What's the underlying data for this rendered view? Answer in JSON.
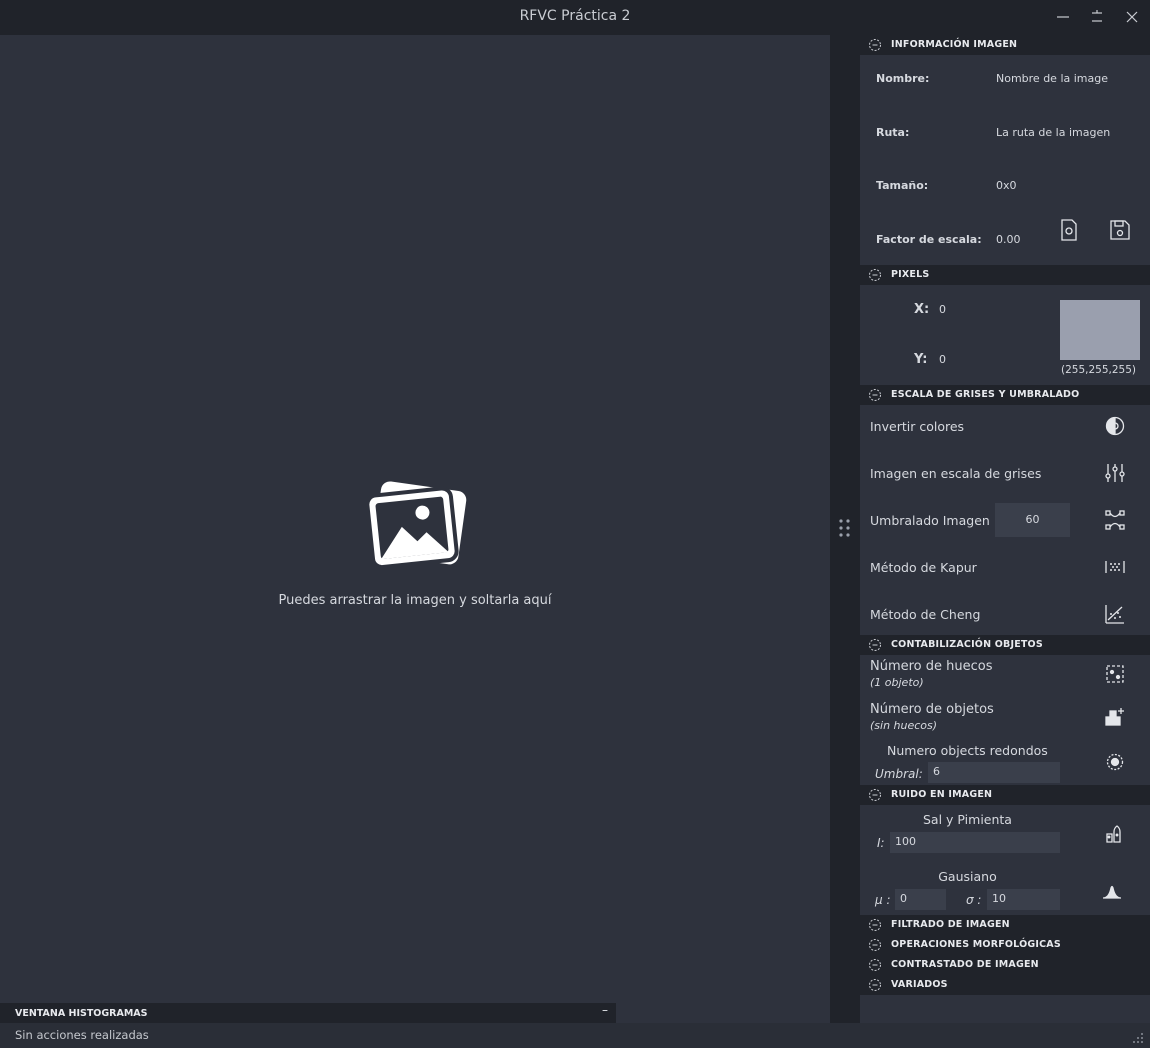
{
  "window": {
    "title": "RFVC Práctica 2"
  },
  "canvas": {
    "drop_text": "Puedes arrastrar la imagen y soltarla aquí",
    "drop_icon": "images-icon"
  },
  "info": {
    "title": "INFORMACIÓN IMAGEN",
    "name_label": "Nombre:",
    "name_value": "Nombre de la image",
    "path_label": "Ruta:",
    "path_value": "La ruta de la imagen",
    "size_label": "Tamaño:",
    "size_value": "0x0",
    "scale_label": "Factor de escala:",
    "scale_value": "0.00"
  },
  "pixels": {
    "title": "PIXELS",
    "x_label": "X:",
    "x_value": "0",
    "y_label": "Y:",
    "y_value": "0",
    "rgb": "(255,255,255)",
    "swatch_color": "#9a9fae"
  },
  "grayscale": {
    "title": "ESCALA DE GRISES Y UMBRALADO",
    "invert": "Invertir colores",
    "gray": "Imagen en escala de grises",
    "threshold": "Umbralado Imagen",
    "threshold_value": "60",
    "kapur": "Método de Kapur",
    "cheng": "Método de Cheng"
  },
  "counting": {
    "title": "CONTABILIZACIÓN OBJETOS",
    "holes": "Número de huecos",
    "holes_sub": "(1 objeto)",
    "objects": "Número de objetos",
    "objects_sub": "(sin huecos)",
    "round": "Numero objects redondos",
    "threshold_label": "Umbral:",
    "threshold_value": "6"
  },
  "noise": {
    "title": "RUIDO EN IMAGEN",
    "salt": "Sal y Pimienta",
    "i_label": "I:",
    "i_value": "100",
    "gauss": "Gausiano",
    "mu_label": "μ :",
    "mu_value": "0",
    "sigma_label": "σ :",
    "sigma_value": "10"
  },
  "collapsed": {
    "filter": "FILTRADO DE IMAGEN",
    "morph": "OPERACIONES MORFOLÓGICAS",
    "contrast": "CONTRASTADO DE IMAGEN",
    "misc": "VARIADOS"
  },
  "histogram": {
    "title": "VENTANA HISTOGRAMAS",
    "minimize": "–"
  },
  "status": {
    "text": "Sin acciones realizadas"
  }
}
